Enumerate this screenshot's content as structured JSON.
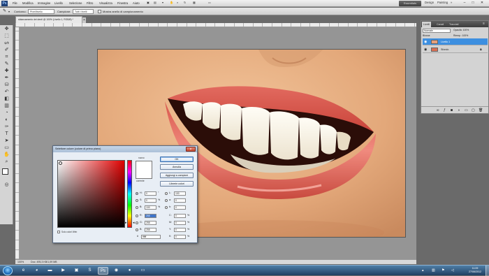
{
  "menubar": {
    "app_icon": "Ps",
    "items": [
      "File",
      "Modifica",
      "Immagine",
      "Livello",
      "Selezione",
      "Filtro",
      "Visualizza",
      "Finestra",
      "Aiuto"
    ],
    "workspace_button": "Essentials",
    "window_controls": [
      "–",
      "□",
      "✕"
    ]
  },
  "options_bar": {
    "sfumatura_label": "Contorno:",
    "sfumatura_value": "Pixel/livello",
    "campione_label": "Campione:",
    "campione_value": "Tutti i livelli",
    "checkbox_label": "Mostra anello di campionamento"
  },
  "document": {
    "tab_title": "sbiancamento dei denti @ 100% (Livello 1, RGB/8) *",
    "tab_close": "×",
    "status_zoom": "100%",
    "status_info": "Doc: 495,3 KB/1,09 MB"
  },
  "layers_panel": {
    "tabs": [
      "Livelli",
      "Canali",
      "Tracciati"
    ],
    "blend_mode": "Normale",
    "opacity_label": "Opacità: 100%",
    "lock_label": "Blocca:",
    "fill_label": "Riemp.: 100%",
    "layers": [
      {
        "name": "Livello 1",
        "selected": true
      },
      {
        "name": "Sfondo",
        "selected": false
      }
    ],
    "bottom_icons": [
      "link-icon",
      "fx-icon",
      "mask-icon",
      "adjustment-icon",
      "folder-icon",
      "new-layer-icon",
      "trash-icon"
    ]
  },
  "color_picker": {
    "title": "Selettore colore (colore di primo piano)",
    "close_label": "×",
    "new_label": "nuovo",
    "current_label": "corrente",
    "buttons": {
      "ok": "OK",
      "cancel": "Annulla",
      "add_swatch": "Aggiungi a campioni",
      "libraries": "Librerie colori"
    },
    "web_only": "Solo colori Web",
    "hsb": [
      {
        "label": "H:",
        "value": "0",
        "unit": "°",
        "selected": true
      },
      {
        "label": "S:",
        "value": "0",
        "unit": "%",
        "selected": false
      },
      {
        "label": "B:",
        "value": "100",
        "unit": "%",
        "selected": false
      }
    ],
    "rgb": [
      {
        "label": "R:",
        "value": "255",
        "selected": true
      },
      {
        "label": "G:",
        "value": "255",
        "selected": false
      },
      {
        "label": "B:",
        "value": "255",
        "selected": false
      }
    ],
    "lab": [
      {
        "label": "L:",
        "value": "100"
      },
      {
        "label": "a:",
        "value": "0"
      },
      {
        "label": "b:",
        "value": "0"
      }
    ],
    "cmyk": [
      {
        "label": "C:",
        "value": "0",
        "unit": "%"
      },
      {
        "label": "M:",
        "value": "0",
        "unit": "%"
      },
      {
        "label": "Y:",
        "value": "0",
        "unit": "%"
      },
      {
        "label": "K:",
        "value": "0",
        "unit": "%"
      }
    ],
    "hex_label": "#",
    "hex_value": "ffffff"
  },
  "taskbar": {
    "clock_time": "11:09",
    "clock_date": "27/06/2012"
  },
  "colors": {
    "photo_skin": "#e3a87a",
    "lip": "#d4524a",
    "selected_layer": "#3d8fe0"
  }
}
